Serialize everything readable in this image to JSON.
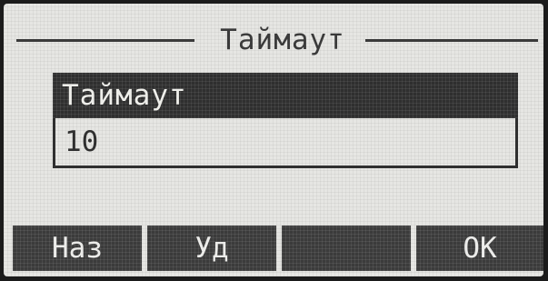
{
  "dialog": {
    "title": "Таймаут"
  },
  "field": {
    "label": "Таймаут",
    "value": "10"
  },
  "softkeys": [
    {
      "label": "Наз"
    },
    {
      "label": "Уд"
    },
    {
      "label": ""
    },
    {
      "label": "OK"
    }
  ]
}
